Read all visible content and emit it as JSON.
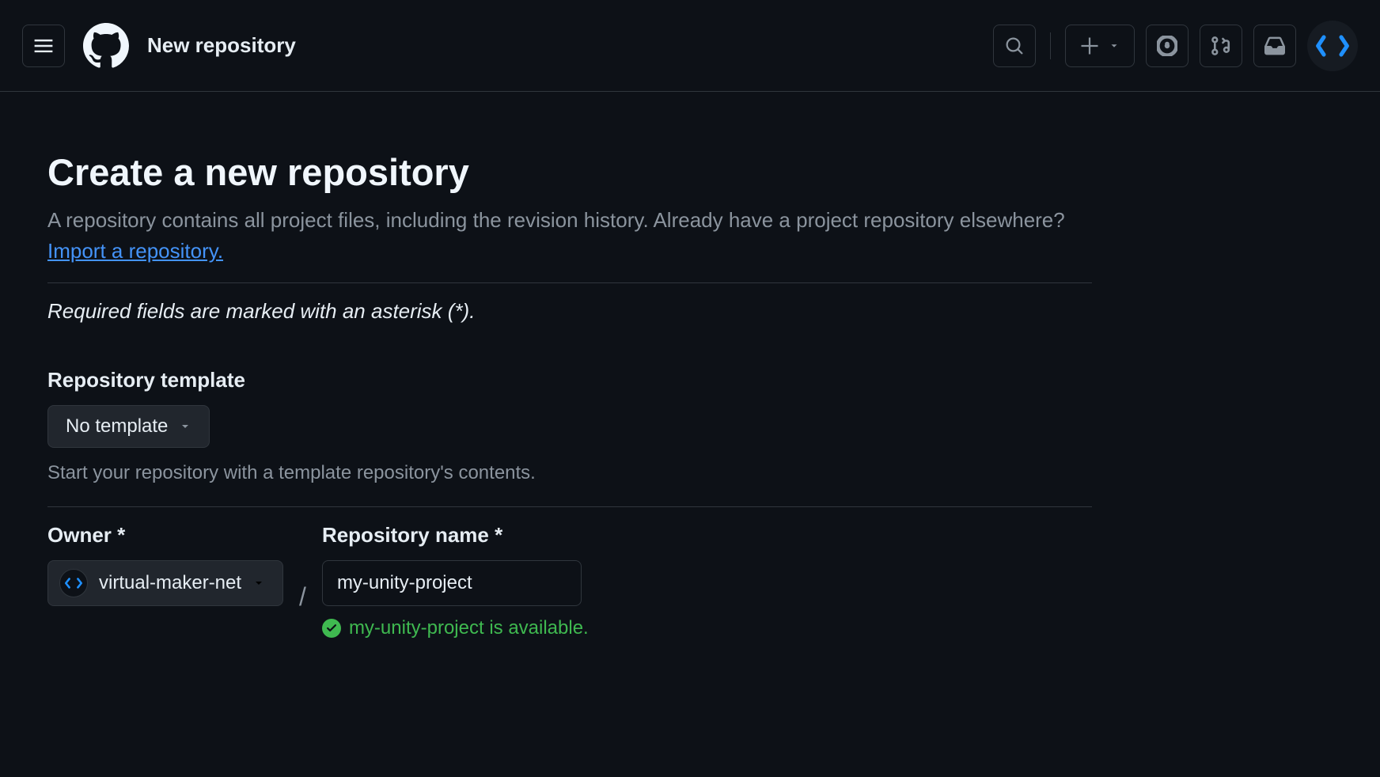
{
  "header": {
    "title": "New repository"
  },
  "page": {
    "heading": "Create a new repository",
    "description_prefix": "A repository contains all project files, including the revision history. Already have a project repository elsewhere? ",
    "import_link": "Import a repository.",
    "required_note": "Required fields are marked with an asterisk (*)."
  },
  "template": {
    "label": "Repository template",
    "selected": "No template",
    "help": "Start your repository with a template repository's contents."
  },
  "owner": {
    "label": "Owner *",
    "selected": "virtual-maker-net"
  },
  "repo": {
    "label": "Repository name *",
    "value": "my-unity-project",
    "availability": "my-unity-project is available."
  }
}
